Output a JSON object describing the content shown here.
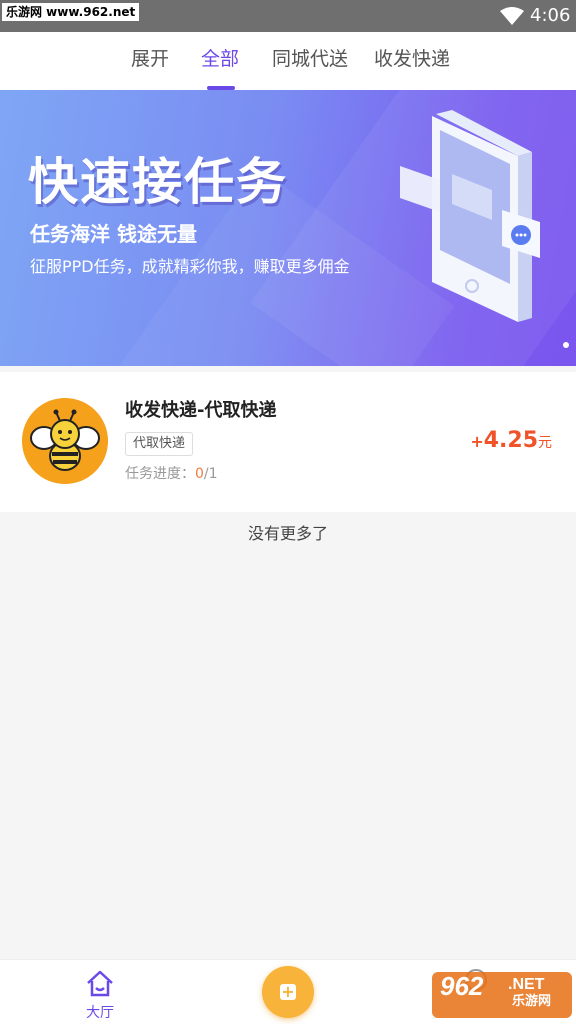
{
  "status_bar": {
    "watermark_text": "乐游网 www.962.net",
    "time": "4:06"
  },
  "tabs": [
    {
      "label": "展开",
      "active": false
    },
    {
      "label": "全部",
      "active": true
    },
    {
      "label": "同城代送",
      "active": false
    },
    {
      "label": "收发快递",
      "active": false
    }
  ],
  "banner": {
    "title": "快速接任务",
    "subtitle": "任务海洋  钱途无量",
    "description": "征服PPD任务，成就精彩你我，赚取更多佣金",
    "page_indicator": {
      "current": 1,
      "total": 1
    }
  },
  "task": {
    "title": "收发快递-代取快递",
    "tag": "代取快递",
    "progress_label": "任务进度：",
    "progress_current": "0",
    "progress_total": "/1",
    "reward_sign": "+",
    "reward_amount": "4.25",
    "reward_unit": "元",
    "avatar_icon": "bee-icon"
  },
  "list_footer": "没有更多了",
  "bottom_nav": {
    "hall_label": "大厅",
    "add_icon": "add-task-icon",
    "mine_icon": "user-icon"
  },
  "watermark": {
    "brand": "962",
    "domain": ".NET",
    "cn": "乐游网"
  },
  "colors": {
    "accent": "#6b49e8",
    "reward": "#f0532a",
    "progress_current": "#f07c3e",
    "add_button": "#f7b33a"
  }
}
